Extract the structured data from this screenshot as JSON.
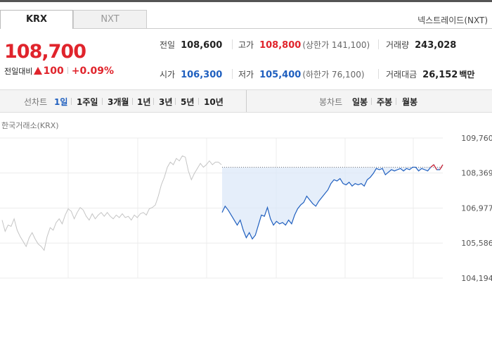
{
  "tabs": [
    {
      "label": "KRX",
      "active": true
    },
    {
      "label": "NXT",
      "active": false
    }
  ],
  "nxt_link": "넥스트레이드(NXT)",
  "quote": {
    "price": "108,700",
    "change_label": "전일대비",
    "change_value": "100",
    "change_pct": "+0.09%",
    "up_color": "#e0242c",
    "down_color": "#1f5fbf"
  },
  "stats": {
    "prev_close": {
      "label": "전일",
      "value": "108,600"
    },
    "open": {
      "label": "시가",
      "value": "106,300"
    },
    "high": {
      "label": "고가",
      "value": "108,800",
      "extra": "(상한가 141,100)"
    },
    "low": {
      "label": "저가",
      "value": "105,400",
      "extra": "(하한가 76,100)"
    },
    "volume": {
      "label": "거래량",
      "value": "243,028"
    },
    "trade_value": {
      "label": "거래대금",
      "value": "26,152",
      "unit": "백만"
    }
  },
  "periods": {
    "line_label": "선차트",
    "line_items": [
      "1일",
      "1주일",
      "3개월",
      "1년",
      "3년",
      "5년",
      "10년"
    ],
    "selected": "1일",
    "candle_label": "봉차트",
    "candle_items": [
      "일봉",
      "주봉",
      "월봉"
    ]
  },
  "exchange_label": "한국거래소(KRX)",
  "chart_data": {
    "type": "line",
    "ylim": [
      104194,
      109760
    ],
    "y_ticks": [
      "109,760",
      "108,369",
      "106,977",
      "105,586",
      "104,194"
    ],
    "y_tick_values": [
      109760,
      108369,
      106977,
      105586,
      104194
    ],
    "prev_close": 108600,
    "grid": true,
    "series": [
      {
        "values": [
          106500,
          106050,
          106300,
          106250,
          106550,
          106100,
          105850,
          105650,
          105450,
          105800,
          106000,
          105750,
          105550,
          105450,
          105300,
          105850,
          106200,
          106100,
          106400,
          106550,
          106350,
          106700,
          106950,
          106850,
          106550,
          106800,
          107000,
          106900,
          106650,
          106500,
          106750,
          106550,
          106700,
          106800,
          106650,
          106800,
          106650,
          106550,
          106700,
          106600,
          106750,
          106600,
          106650,
          106500,
          106700,
          106600,
          106750,
          106800,
          106700,
          106950,
          107000,
          107100,
          107450,
          107900,
          108200,
          108600,
          108800,
          108700,
          108950,
          108850,
          109050,
          109000,
          108450,
          108100,
          108350,
          108550,
          108750,
          108600,
          108700,
          108850,
          108700,
          108800,
          108800,
          108700
        ]
      },
      {
        "values": [
          106800,
          107050,
          106900,
          106700,
          106500,
          106300,
          106500,
          106100,
          105800,
          106000,
          105750,
          105900,
          106300,
          106700,
          106650,
          107000,
          106550,
          106300,
          106450,
          106350,
          106400,
          106300,
          106500,
          106350,
          106700,
          106950,
          107100,
          107200,
          107450,
          107300,
          107150,
          107050,
          107250,
          107400,
          107550,
          107700,
          107950,
          108100,
          108050,
          108150,
          107950,
          107900,
          108000,
          107850,
          107950,
          107900,
          107950,
          107850,
          108100,
          108200,
          108350,
          108550,
          108500,
          108550,
          108300,
          108400,
          108500,
          108450,
          108500,
          108550,
          108450,
          108550,
          108500,
          108600,
          108600,
          108450,
          108550,
          108500,
          108450,
          108600,
          108700,
          108500,
          108500,
          108700
        ]
      }
    ]
  }
}
